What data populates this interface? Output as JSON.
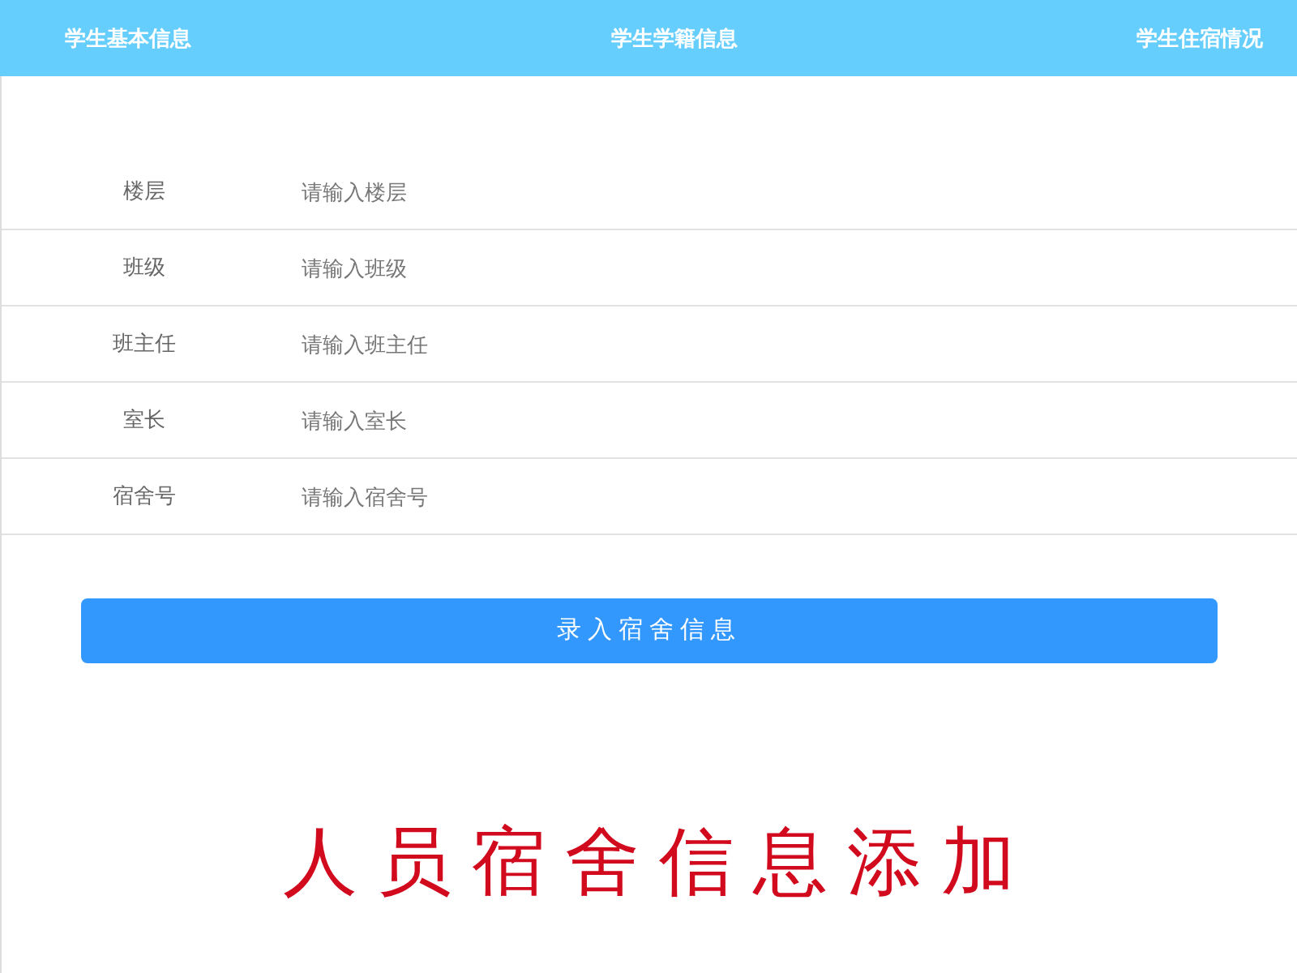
{
  "tabs": [
    {
      "label": "学生基本信息"
    },
    {
      "label": "学生学籍信息"
    },
    {
      "label": "学生住宿情况"
    }
  ],
  "form": {
    "fields": [
      {
        "label": "楼层",
        "placeholder": "请输入楼层"
      },
      {
        "label": "班级",
        "placeholder": "请输入班级"
      },
      {
        "label": "班主任",
        "placeholder": "请输入班主任"
      },
      {
        "label": "室长",
        "placeholder": "请输入室长"
      },
      {
        "label": "宿舍号",
        "placeholder": "请输入宿舍号"
      }
    ]
  },
  "submit_button": {
    "label": "录入宿舍信息"
  },
  "caption": "人员宿舍信息添加"
}
